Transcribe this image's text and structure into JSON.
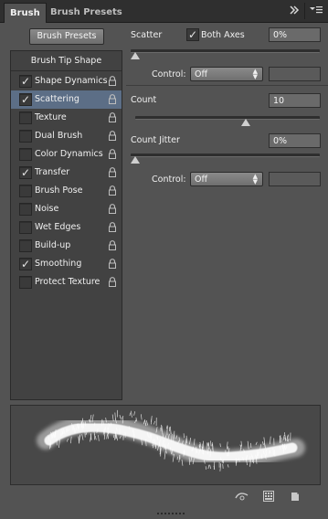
{
  "tabs": [
    {
      "label": "Brush",
      "active": true
    },
    {
      "label": "Brush Presets",
      "active": false
    }
  ],
  "header_icons": [
    "double-chevron-right-icon",
    "panel-menu-icon"
  ],
  "brush_presets_button": "Brush Presets",
  "brush_tip_shape": "Brush Tip Shape",
  "options": [
    {
      "label": "Shape Dynamics",
      "checked": true,
      "selected": false
    },
    {
      "label": "Scattering",
      "checked": true,
      "selected": true
    },
    {
      "label": "Texture",
      "checked": false,
      "selected": false
    },
    {
      "label": "Dual Brush",
      "checked": false,
      "selected": false
    },
    {
      "label": "Color Dynamics",
      "checked": false,
      "selected": false
    },
    {
      "label": "Transfer",
      "checked": true,
      "selected": false
    },
    {
      "label": "Brush Pose",
      "checked": false,
      "selected": false
    },
    {
      "label": "Noise",
      "checked": false,
      "selected": false
    },
    {
      "label": "Wet Edges",
      "checked": false,
      "selected": false
    },
    {
      "label": "Build-up",
      "checked": false,
      "selected": false
    },
    {
      "label": "Smoothing",
      "checked": true,
      "selected": false
    },
    {
      "label": "Protect Texture",
      "checked": false,
      "selected": false
    }
  ],
  "scatter": {
    "label": "Scatter",
    "both_axes_label": "Both Axes",
    "both_axes_checked": true,
    "value": "0%",
    "slider": 0,
    "control_label": "Control:",
    "control_value": "Off"
  },
  "count": {
    "label": "Count",
    "value": "10",
    "slider": 0.6
  },
  "count_jitter": {
    "label": "Count Jitter",
    "value": "0%",
    "slider": 0,
    "control_label": "Control:",
    "control_value": "Off"
  },
  "bottom_icons": [
    "toggle-live-tip-preview-icon",
    "brush-grid-icon",
    "create-new-brush-icon"
  ],
  "colors": {
    "panel": "#535353",
    "selected_row": "#5c6e86",
    "dark_bar": "#2f2f2f"
  }
}
